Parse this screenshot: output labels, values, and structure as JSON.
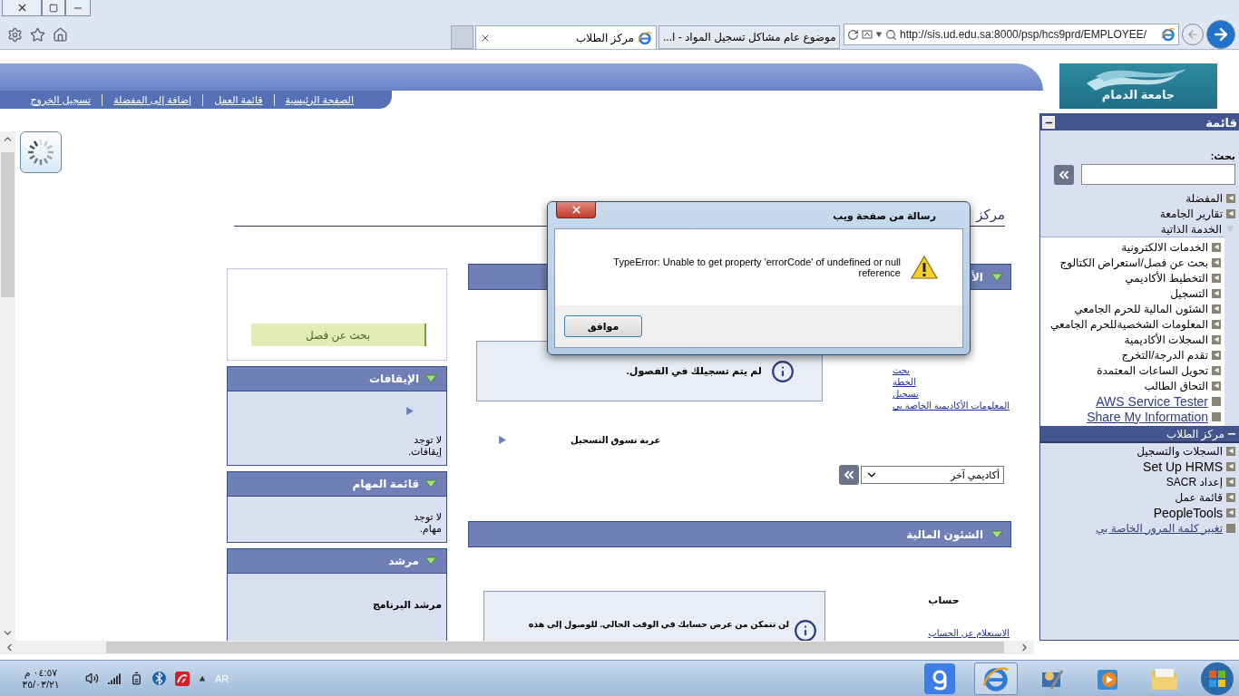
{
  "browser": {
    "tabs": [
      {
        "title": "موضوع عام مشاكل تسجيل المواد - ا...",
        "selected": false
      },
      {
        "title": "مركز الطلاب",
        "selected": true
      }
    ],
    "address": "http://sis.ud.edu.sa:8000/psp/hcs9prd/EMPLOYEE/"
  },
  "portal": {
    "logo_text": "جامعة الدمام",
    "nav_links": [
      "الصفحة الرئيسية",
      "قائمة العمل",
      "إضافة إلى المفضلة",
      "تسجيل الخروج"
    ],
    "menu": {
      "title": "قائمة",
      "search_label": "بحث:",
      "items": [
        {
          "label": "المفضلة",
          "kind": "folder"
        },
        {
          "label": "تقارير الجامعة",
          "kind": "folder"
        },
        {
          "label": "الخدمة الذاتية",
          "kind": "group",
          "expanded": true,
          "children": [
            {
              "label": "الخدمات الالكترونية",
              "kind": "folder"
            },
            {
              "label": "بحث عن فصل/استعراض الكتالوج",
              "kind": "folder"
            },
            {
              "label": "التخطيط الأكاديمي",
              "kind": "folder"
            },
            {
              "label": "التسجيل",
              "kind": "folder"
            },
            {
              "label": "الشئون المالية للحرم الجامعي",
              "kind": "folder"
            },
            {
              "label": "المعلومات الشخصيةللحرم الجامعي",
              "kind": "folder"
            },
            {
              "label": "السجلات الأكاديمية",
              "kind": "folder"
            },
            {
              "label": "تقدم الدرجة/التخرج",
              "kind": "folder"
            },
            {
              "label": "تحويل الساعات المعتمدة",
              "kind": "folder"
            },
            {
              "label": "التحاق الطالب",
              "kind": "folder"
            },
            {
              "label": "AWS Service Tester",
              "kind": "link"
            },
            {
              "label": "Share My Information",
              "kind": "link"
            }
          ]
        },
        {
          "label": "مركز الطلاب",
          "kind": "current"
        },
        {
          "label": "السجلات والتسجيل",
          "kind": "folder"
        },
        {
          "label": "Set Up HRMS",
          "kind": "folder"
        },
        {
          "label": "إعداد SACR",
          "kind": "folder"
        },
        {
          "label": "قائمة عمل",
          "kind": "folder"
        },
        {
          "label": "PeopleTools",
          "kind": "folder"
        },
        {
          "label": "تغيير كلمة المرور الخاصة بي",
          "kind": "link"
        }
      ]
    },
    "page_heading": "مركز",
    "search_class_button": "بحث عن فصل",
    "panels": [
      {
        "title": "الإيقافات",
        "kind": "holds",
        "lines": [
          "لا توجد",
          "إيقافات."
        ]
      },
      {
        "title": "قائمة المهام",
        "kind": "tasks",
        "lines": [
          "لا توجد",
          "مهام."
        ]
      },
      {
        "title": "مرشد",
        "kind": "advisor",
        "lines": [
          "مرشد البرنامج"
        ]
      }
    ],
    "academics": {
      "title": "الأ",
      "notice": "لم يتم تسجيلك في الفصول.",
      "links": [
        "بحث",
        "الخطة",
        "تسجيل",
        "المعلومات الأكاديمية الخاصة بي"
      ],
      "cart": "عربة تسوق التسجيل",
      "select_value": "أكاديمي آخر"
    },
    "finances": {
      "title": "الشئون المالية",
      "label": "حساب",
      "notice": "لن تتمكن من عرض حسابك في الوقت الحالي. للوصول إلى هذه",
      "links": [
        "الاستعلام عن الحساب"
      ]
    }
  },
  "dialog": {
    "title": "رسالة من صفحة ويب",
    "message": "TypeError: Unable to get property 'errorCode' of undefined or null reference",
    "button": "موافق"
  },
  "taskbar": {
    "time": "٠٤:٥٧ م",
    "date": "٣٥/٠٣/٢١",
    "language": "AR"
  }
}
